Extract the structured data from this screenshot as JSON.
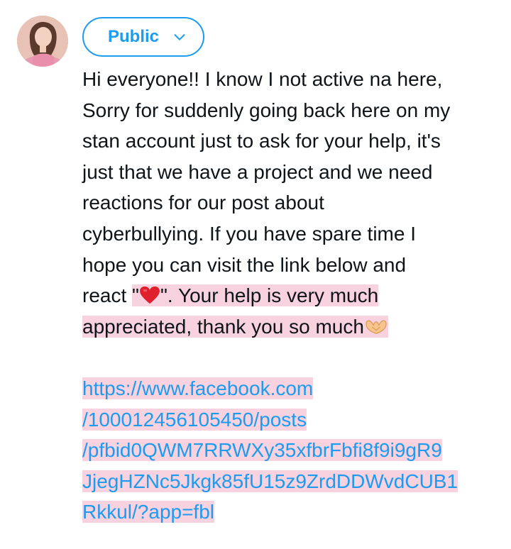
{
  "composer": {
    "audience_label": "Public",
    "lines": [
      "Hi everyone!! I know I not active na here,",
      "Sorry for suddenly going back here on my",
      "stan account just to ask for your help, it's",
      "just that we have a project and we need",
      "reactions for our post about",
      "cyberbullying. If you have spare time I",
      "hope you can visit the link below and"
    ],
    "line8_before": "react ",
    "line8_quote_open": "\"",
    "line8_quote_close": "\". Your help is very much",
    "line9": "appreciated, thank you so much",
    "link_lines": [
      "https://www.facebook.com",
      "/100012456105450/posts",
      "/pfbid0QWM7RRWXy35xfbrFbfi8f9i9gR9",
      "JjegHZNc5Jkgk85fU15z9ZrdDDWvdCUB1",
      "Rkkul/?app=fbl"
    ]
  },
  "icons": {
    "heart": "red-heart-emoji",
    "hands": "heart-hands-emoji",
    "chevron": "chevron-down-icon"
  },
  "colors": {
    "accent": "#1d9bf0",
    "highlight": "#f8d3df",
    "text": "#0f1419"
  }
}
